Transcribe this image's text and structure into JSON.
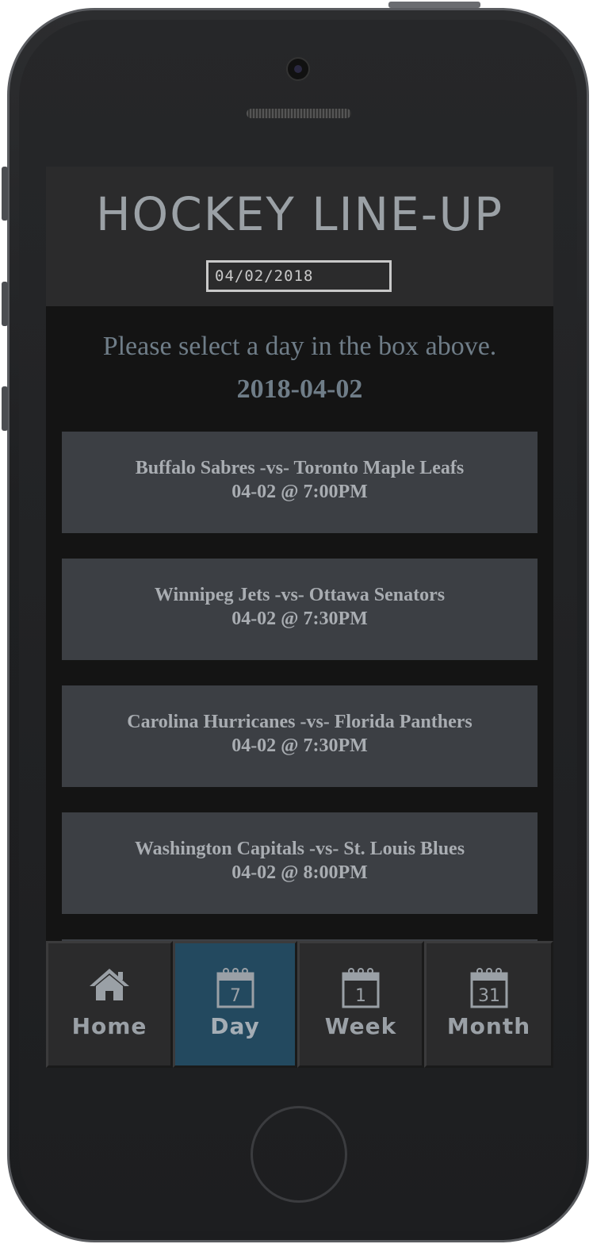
{
  "app": {
    "title": "HOCKEY LINE-UP",
    "date_input_value": "04/02/2018"
  },
  "main": {
    "prompt": "Please select a day in the box above.",
    "selected_date": "2018-04-02",
    "games": [
      {
        "teams": "Buffalo Sabres -vs- Toronto Maple Leafs",
        "time": "04-02 @ 7:00PM"
      },
      {
        "teams": "Winnipeg Jets -vs- Ottawa Senators",
        "time": "04-02 @ 7:30PM"
      },
      {
        "teams": "Carolina Hurricanes -vs- Florida Panthers",
        "time": "04-02 @ 7:30PM"
      },
      {
        "teams": "Washington Capitals -vs- St. Louis Blues",
        "time": "04-02 @ 8:00PM"
      }
    ]
  },
  "nav": {
    "items": [
      {
        "label": "Home",
        "icon": "home-icon"
      },
      {
        "label": "Day",
        "icon": "calendar-day-icon",
        "icon_text": "7",
        "active": true
      },
      {
        "label": "Week",
        "icon": "calendar-week-icon",
        "icon_text": "1"
      },
      {
        "label": "Month",
        "icon": "calendar-month-icon",
        "icon_text": "31"
      }
    ],
    "active_color": "#23495f"
  }
}
